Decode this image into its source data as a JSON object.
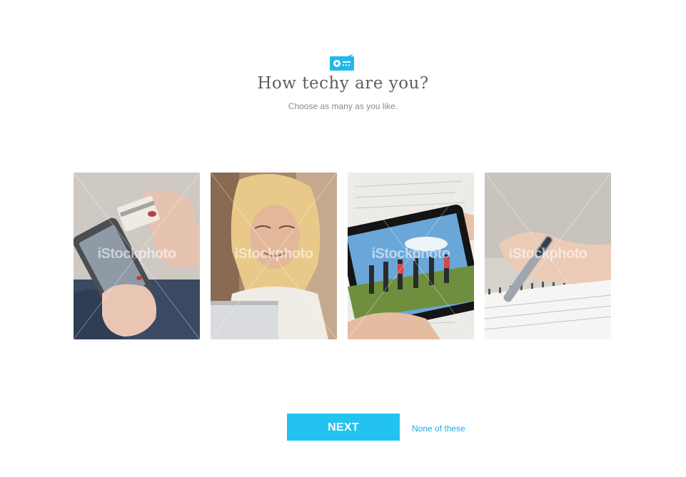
{
  "header": {
    "icon": "radio-icon",
    "title": "How techy are you?",
    "subtitle": "Choose as many as you like."
  },
  "cards": [
    {
      "subject": "phone-and-credit-card-photo",
      "watermark": "iStockphoto"
    },
    {
      "subject": "woman-at-laptop-photo",
      "watermark": "iStockphoto"
    },
    {
      "subject": "smartphone-photo-of-group",
      "watermark": "iStockphoto"
    },
    {
      "subject": "hand-writing-with-pen-photo",
      "watermark": "iStockphoto"
    }
  ],
  "actions": {
    "next_label": "NEXT",
    "none_label": "None of these"
  },
  "colors": {
    "accent": "#22c3ee",
    "link": "#22a9e6",
    "title": "#5e5e5e",
    "subtitle": "#8a8a8a"
  }
}
